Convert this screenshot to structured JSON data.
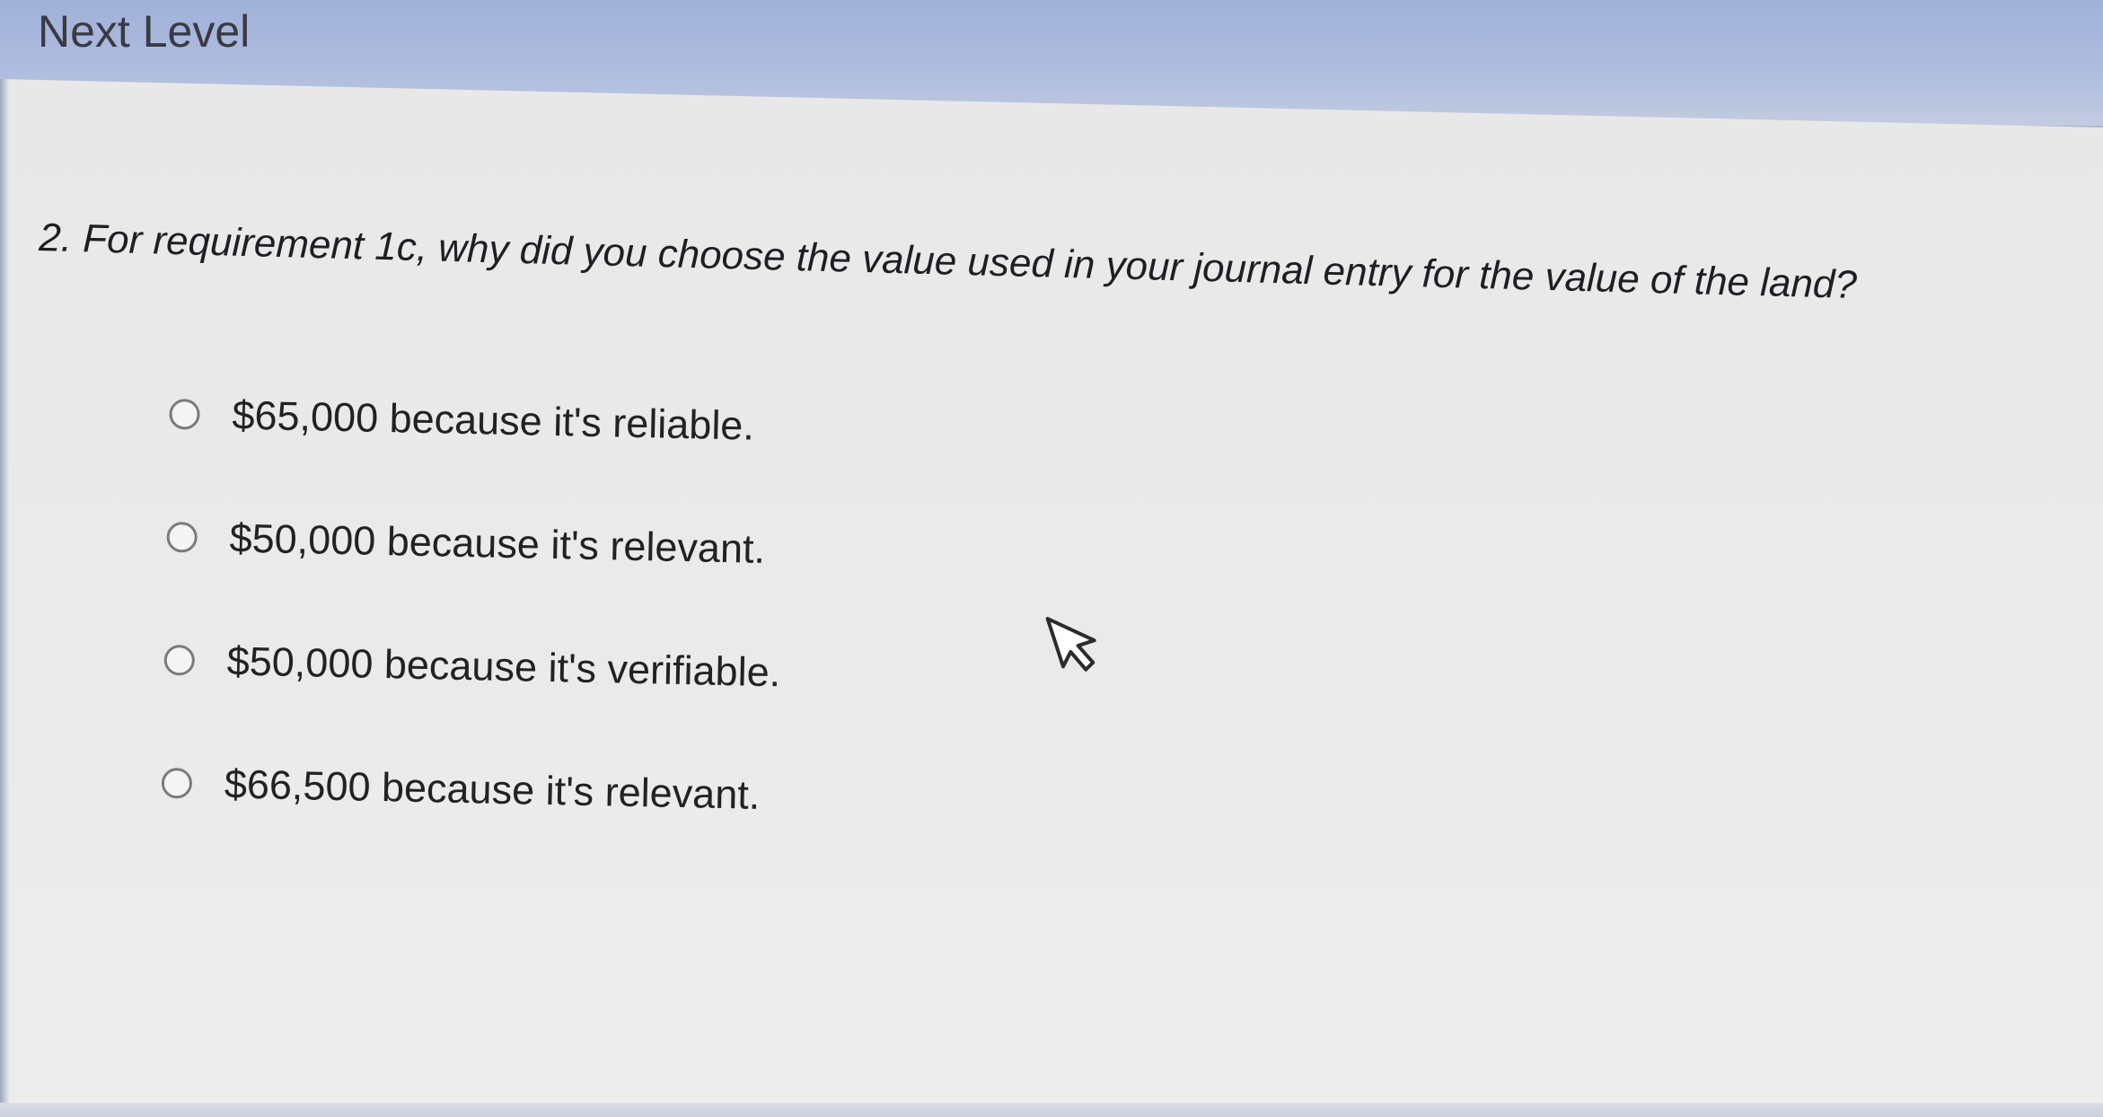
{
  "header": {
    "title": "Next Level"
  },
  "question": {
    "text": "2. For requirement 1c, why did you choose the value used in your journal entry for the value of the land?"
  },
  "options": [
    {
      "label": "$65,000 because it's reliable.",
      "selected": false
    },
    {
      "label": "$50,000 because it's relevant.",
      "selected": false
    },
    {
      "label": "$50,000 because it's verifiable.",
      "selected": false
    },
    {
      "label": "$66,500 because it's relevant.",
      "selected": false
    }
  ],
  "icons": {
    "cursor": "mouse-pointer-icon",
    "radio": "radio-button-icon"
  },
  "colors": {
    "header": "#a9b8dc",
    "background": "#e9e9e9",
    "text": "#1e1e24",
    "radio_border": "#7a7a80"
  }
}
